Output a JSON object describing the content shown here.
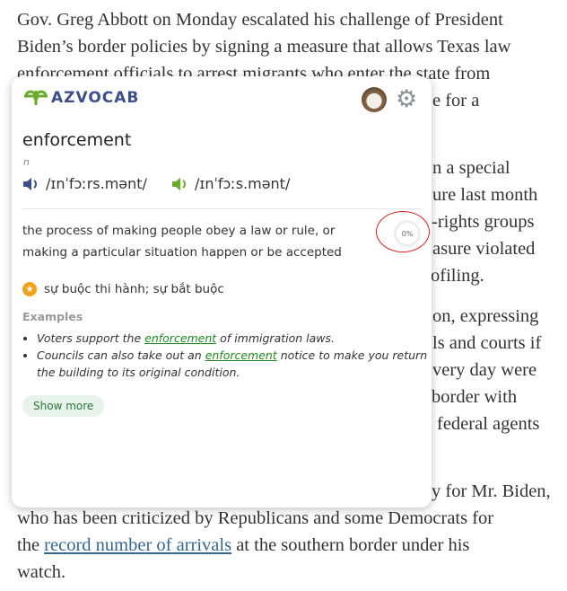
{
  "article": {
    "line1": "Gov. Greg Abbott on Monday escalated his challenge of President",
    "line2": "Biden’s border policies by signing a measure that allows Texas law",
    "line3": "enforcement officials to arrest migrants who enter the state from",
    "frag4": "e for a",
    "frag5": "n a special",
    "frag6": "ure last month",
    "frag7": "-rights groups",
    "frag8": "asure violated",
    "frag9": "ofiling.",
    "frag10": "on, expressing",
    "frag11": "ls and courts if",
    "frag12": "very day were",
    "frag13": "border with",
    "frag14": "federal agents",
    "frag15": "y for Mr. Biden,",
    "line16": "who has been criticized by Republicans and some Democrats for",
    "line17_pre": "the ",
    "line17_link": "record number of arrivals",
    "line17_post": " at the southern border under his",
    "line18": "watch."
  },
  "popup": {
    "logo_text": "AZVOCAB",
    "word": "enforcement",
    "pos": "n",
    "pron_us": "/ɪnˈfɔːrs.mənt/",
    "pron_uk": "/ɪnˈfɔːs.mənt/",
    "definition": "the process of making people obey a law or rule, or making a particular situation happen or be accepted",
    "progress": "0%",
    "translation": "sự buộc thi hành; sự bắt buộc",
    "examples_label": "Examples",
    "examples": [
      {
        "pre": "Voters support the ",
        "word": "enforcement",
        "post": " of immigration laws."
      },
      {
        "pre": "Councils can also take out an ",
        "word": "enforcement",
        "post": " notice to make you return the building to its original condition."
      }
    ],
    "show_more": "Show more",
    "colors": {
      "brand_blue": "#3d4f8a",
      "brand_green": "#6aaa2a",
      "annotation_red": "#e41b1b"
    }
  }
}
